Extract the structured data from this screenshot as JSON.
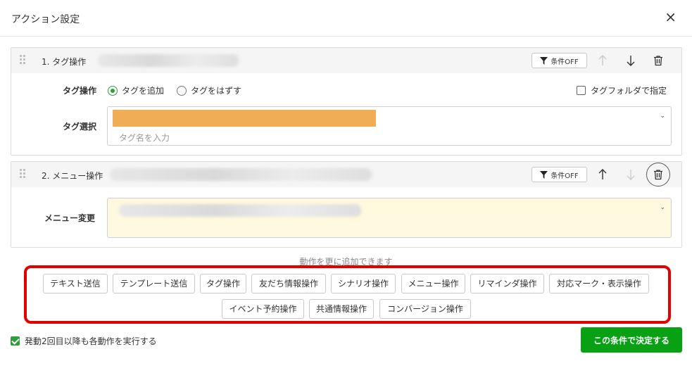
{
  "header": {
    "title": "アクション設定",
    "close_icon": "×"
  },
  "actions": [
    {
      "title": "1. タグ操作",
      "condition_button": "条件OFF",
      "tag_op_label": "タグ操作",
      "radio_add": "タグを追加",
      "radio_remove": "タグをはずす",
      "radio_selected": "add",
      "folder_checkbox": "タグフォルダで指定",
      "folder_checked": false,
      "tag_select_label": "タグ選択",
      "tag_placeholder": "タグ名を入力"
    },
    {
      "title": "2. メニュー操作",
      "condition_button": "条件OFF",
      "menu_change_label": "メニュー変更"
    }
  ],
  "add_hint": "動作を更に追加できます",
  "action_buttons_row1": [
    "テキスト送信",
    "テンプレート送信",
    "タグ操作",
    "友だち情報操作",
    "シナリオ操作",
    "メニュー操作",
    "リマインダ操作",
    "対応マーク・表示操作"
  ],
  "action_buttons_row2": [
    "イベント予約操作",
    "共通情報操作",
    "コンバージョン操作"
  ],
  "footer": {
    "repeat_checkbox": "発動2回目以降も各動作を実行する",
    "repeat_checked": true,
    "submit_label": "この条件で決定する"
  },
  "colors": {
    "accent": "#08a114",
    "highlight": "#e30000",
    "tag_chip": "#f0ad55",
    "menu_bg": "#fff9df"
  }
}
